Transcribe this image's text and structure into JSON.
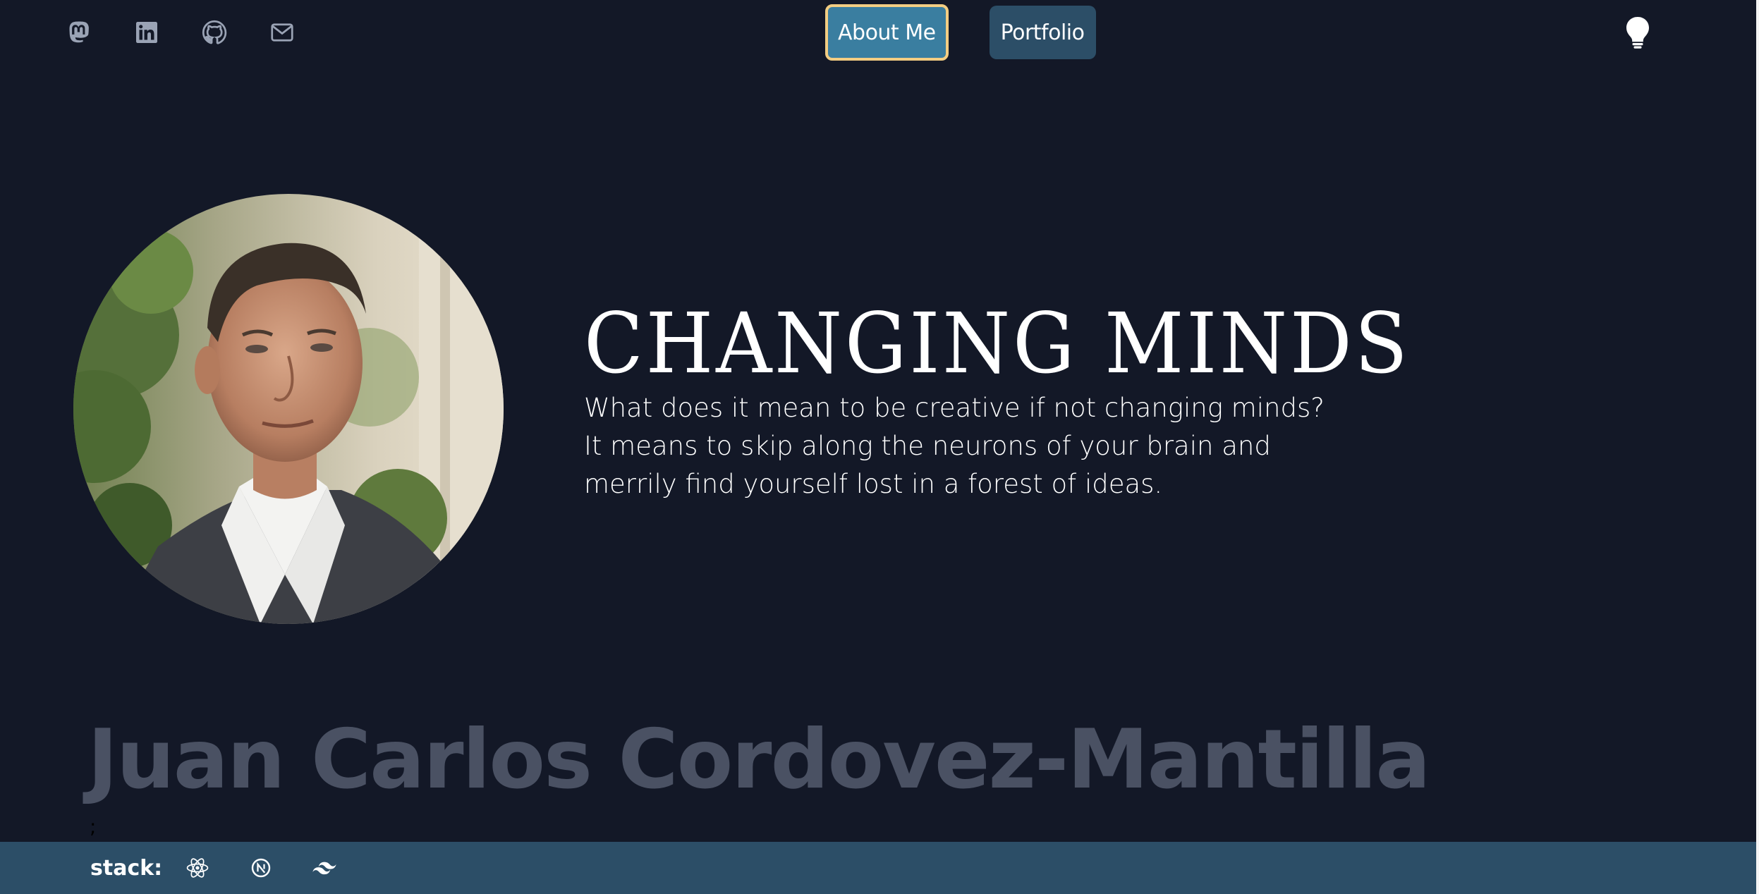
{
  "header": {
    "social_icons": [
      "mastodon-icon",
      "linkedin-icon",
      "github-icon",
      "mail-icon"
    ],
    "nav": {
      "about_label": "About Me",
      "portfolio_label": "Portfolio"
    },
    "theme_toggle_icon": "lightbulb-icon"
  },
  "hero": {
    "headline": "CHANGING MINDS",
    "tagline_lines": [
      "What does it mean to be creative if not changing minds?",
      "It means to skip along the neurons of your brain and",
      "merrily find yourself lost in a forest of ideas."
    ],
    "name": "Juan Carlos Cordovez-Mantilla",
    "stray_char": ";"
  },
  "footer": {
    "stack_label": "stack:",
    "stack_icons": [
      "react-icon",
      "nextjs-icon",
      "tailwind-icon"
    ]
  },
  "colors": {
    "background": "#131827",
    "nav_button": "#2c4e67",
    "nav_active": "#3a7ea0",
    "nav_active_border": "#f3cd82",
    "name_text": "#4a5163",
    "footer": "#2c4e67"
  }
}
